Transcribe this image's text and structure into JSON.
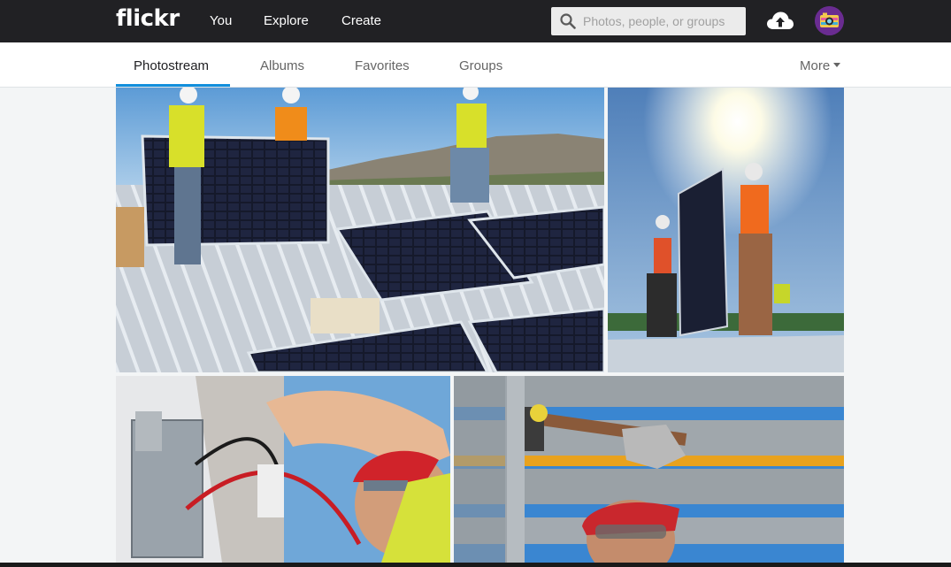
{
  "header": {
    "logo": "flickr",
    "nav": [
      "You",
      "Explore",
      "Create"
    ],
    "search_placeholder": "Photos, people, or groups",
    "icons": {
      "search": "search-icon",
      "upload": "cloud-upload-icon",
      "avatar": "avatar"
    }
  },
  "subnav": {
    "tabs": [
      "Photostream",
      "Albums",
      "Favorites",
      "Groups"
    ],
    "active_tab": "Photostream",
    "more_label": "More"
  },
  "photos": [
    {
      "name": "solar-crew-roof-photo",
      "depicts": "workers installing solar panels on roof"
    },
    {
      "name": "solar-panel-sun-photo",
      "depicts": "worker lifting solar panel toward sun"
    },
    {
      "name": "electrical-wiring-photo",
      "depicts": "worker with hard hat pulling red cable"
    },
    {
      "name": "hammer-rail-photo",
      "depicts": "worker hammering metal rail"
    }
  ],
  "colors": {
    "topbar": "#212124",
    "accent": "#128fdc",
    "avatar_bg": "#6a2c91"
  }
}
